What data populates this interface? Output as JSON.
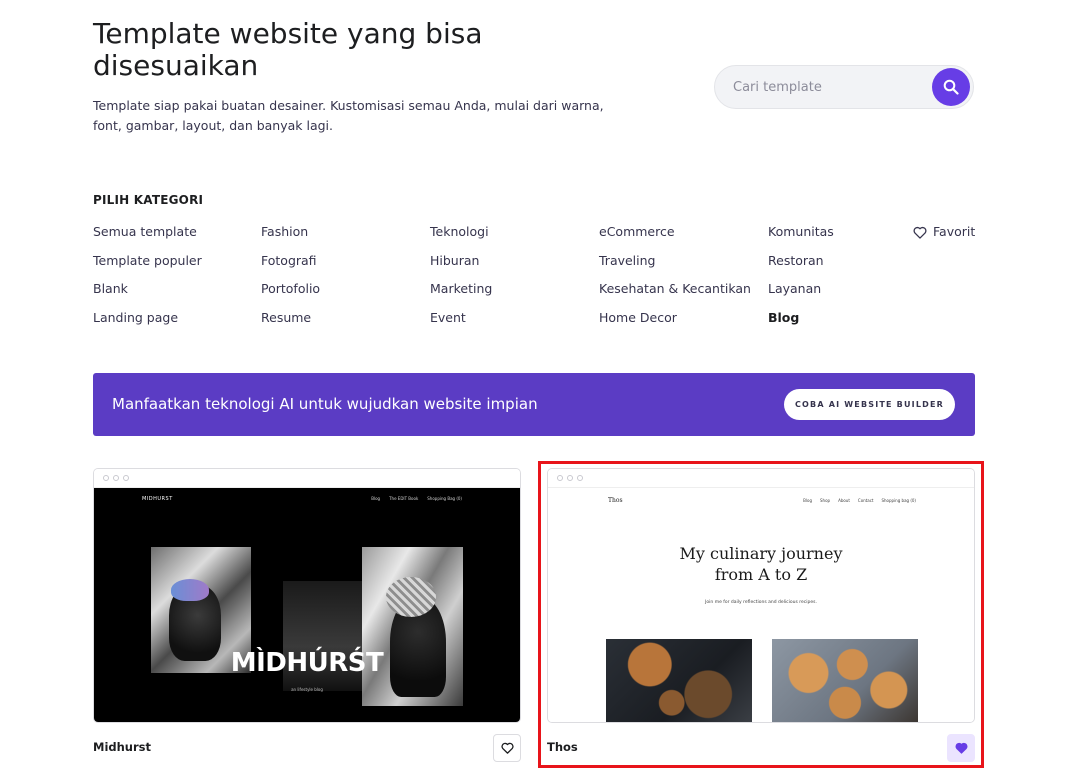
{
  "hero": {
    "title": "Template website yang bisa disesuaikan",
    "description": "Template siap pakai buatan desainer. Kustomisasi semau Anda, mulai dari warna, font, gambar, layout, dan banyak lagi."
  },
  "search": {
    "placeholder": "Cari template",
    "button_icon": "search-icon"
  },
  "categories": {
    "title": "PILIH KATEGORI",
    "columns": [
      [
        "Semua template",
        "Template populer",
        "Blank",
        "Landing page"
      ],
      [
        "Fashion",
        "Fotografi",
        "Portofolio",
        "Resume"
      ],
      [
        "Teknologi",
        "Hiburan",
        "Marketing",
        "Event"
      ],
      [
        "eCommerce",
        "Traveling",
        "Kesehatan & Kecantikan",
        "Home Decor"
      ],
      [
        "Komunitas",
        "Restoran",
        "Layanan",
        "Blog"
      ]
    ],
    "active": "Blog",
    "favorite_label": "Favorit"
  },
  "banner": {
    "text": "Manfaatkan teknologi AI untuk wujudkan website impian",
    "button_label": "COBA AI WEBSITE BUILDER"
  },
  "templates": [
    {
      "name": "Midhurst",
      "favorited": false,
      "preview": {
        "logo": "MIDHURST",
        "nav": [
          "Blog",
          "The EDIT Book",
          "Shopping Bag (0)"
        ],
        "headline": "MÌDHÚRŚT",
        "subline": "an lifestyle blog"
      }
    },
    {
      "name": "Thos",
      "favorited": true,
      "preview": {
        "logo": "Thos",
        "nav": [
          "Blog",
          "Shop",
          "About",
          "Contact",
          "Shopping bag (0)"
        ],
        "headline_line1": "My culinary journey",
        "headline_line2": "from A to Z",
        "subline": "Join me for daily reflections and delicious recipes."
      }
    }
  ],
  "colors": {
    "accent": "#673de6",
    "banner_bg": "#5b3cc4",
    "favorite_bg": "#ebe4ff",
    "highlight": "#e8141a"
  }
}
